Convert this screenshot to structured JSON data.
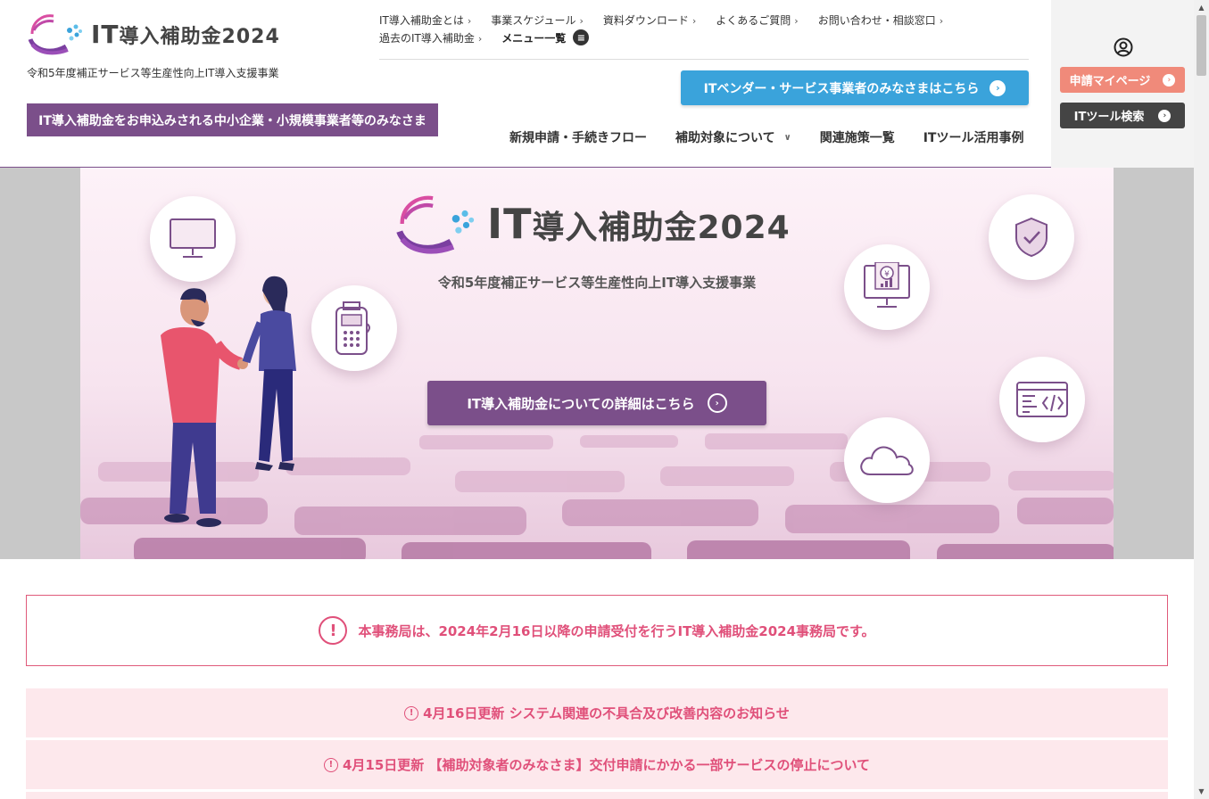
{
  "header": {
    "logo_text_it": "IT",
    "logo_text_rest": "導入補助金2024",
    "subtitle": "令和5年度補正サービス等生産性向上IT導入支援事業",
    "audience_label": "IT導入補助金をお申込みされる中小企業・小規模事業者等のみなさま",
    "util_nav": {
      "row1": [
        "IT導入補助金とは",
        "事業スケジュール",
        "資料ダウンロード",
        "よくあるご質問",
        "お問い合わせ・相談窓口"
      ],
      "row2": [
        "過去のIT導入補助金"
      ],
      "menu_label": "メニュー一覧"
    },
    "vendor_button": "ITベンダー・サービス事業者のみなさまはこちら",
    "main_nav": [
      "新規申請・手続きフロー",
      "補助対象について",
      "関連施策一覧",
      "ITツール活用事例"
    ],
    "mypage_button": "申請マイページ",
    "toolsearch_button": "ITツール検索"
  },
  "hero": {
    "logo_text_it": "IT",
    "logo_text_rest": "導入補助金2024",
    "subtitle": "令和5年度補正サービス等生産性向上IT導入支援事業",
    "cta": "IT導入補助金についての詳細はこちら"
  },
  "notice": {
    "main": "本事務局は、2024年2月16日以降の申請受付を行うIT導入補助金2024事務局です。",
    "items": [
      "4月16日更新 システム関連の不具合及び改善内容のお知らせ",
      "4月15日更新 【補助対象者のみなさま】交付申請にかかる一部サービスの停止について"
    ]
  },
  "colors": {
    "brand_purple": "#7b4f8a",
    "vendor_blue": "#3aa3db",
    "mypage_salmon": "#f08a7a",
    "notice_pink": "#e0507a",
    "notice_bg": "#fde8ec"
  },
  "icons": [
    "user-icon",
    "menu-icon",
    "monitor-icon",
    "payment-terminal-icon",
    "shield-check-icon",
    "yen-monitor-icon",
    "code-window-icon",
    "cloud-icon"
  ]
}
